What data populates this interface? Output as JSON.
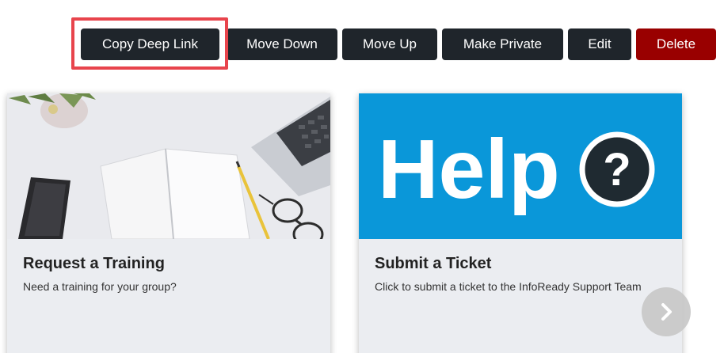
{
  "toolbar": {
    "copy_deep_link": "Copy Deep Link",
    "move_down": "Move Down",
    "move_up": "Move Up",
    "make_private": "Make Private",
    "edit": "Edit",
    "delete": "Delete"
  },
  "cards": [
    {
      "title": "Request a Training",
      "description": "Need a training for your group?",
      "image": "desk-notebook-photo"
    },
    {
      "title": "Submit a Ticket",
      "description": "Click to submit a ticket to the InfoReady Support Team",
      "image": "help-banner",
      "banner_text": "Help",
      "banner_symbol": "?"
    }
  ],
  "colors": {
    "button_dark": "#1f252b",
    "button_delete": "#990000",
    "highlight": "#e8444c",
    "help_blue": "#0a97d9",
    "card_bg": "#ebedf1"
  },
  "icons": {
    "next": "chevron-right-icon"
  }
}
